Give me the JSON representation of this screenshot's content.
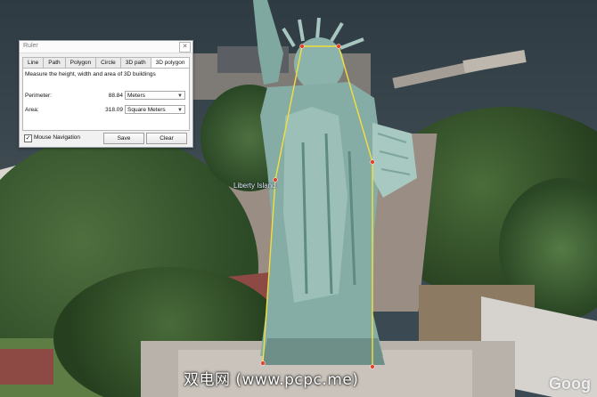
{
  "ruler": {
    "title": "Ruler",
    "close_icon": "close-icon",
    "tabs": [
      "Line",
      "Path",
      "Polygon",
      "Circle",
      "3D path",
      "3D polygon"
    ],
    "active_tab": "3D polygon",
    "description": "Measure the height, width and area of 3D buildings",
    "perimeter": {
      "label": "Perimeter:",
      "value": "88.84",
      "unit": "Meters"
    },
    "area": {
      "label": "Area:",
      "value": "318.09",
      "unit": "Square Meters"
    },
    "mouse_navigation": {
      "label": "Mouse Navigation",
      "checked": true
    },
    "save_label": "Save",
    "clear_label": "Clear"
  },
  "map": {
    "place_label": "Liberty Island",
    "measure_line_color": "#f2e03a",
    "measure_point_color": "#e0432a"
  },
  "overlay": {
    "watermark": "双电网 (www.pcpc.me)",
    "google_logo": "Goog"
  }
}
